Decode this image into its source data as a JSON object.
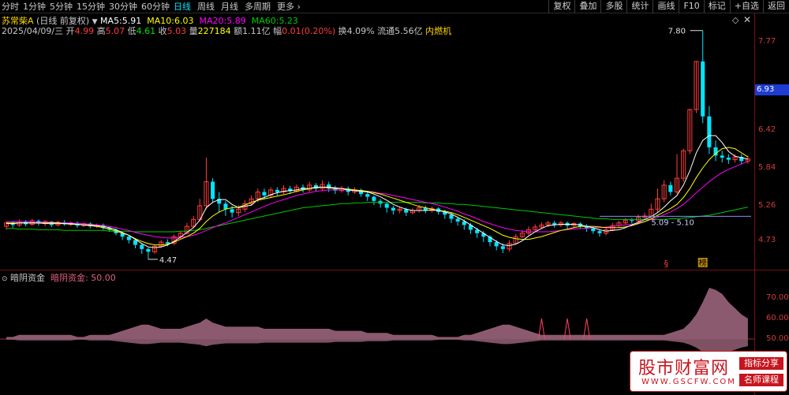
{
  "toolbar": {
    "periods": [
      "分时",
      "1分钟",
      "5分钟",
      "15分钟",
      "30分钟",
      "60分钟",
      "日线",
      "周线",
      "月线",
      "多周期",
      "更多"
    ],
    "active_period": "日线",
    "more_arrow": "›",
    "right_buttons": [
      "复权",
      "叠加",
      "多股",
      "统计",
      "画线",
      "F10",
      "标记",
      "+自选",
      "返回"
    ]
  },
  "stock": {
    "name": "苏常柴A",
    "mode": "(日线 前复权)",
    "ma5_label": "MA5:",
    "ma5": "5.91",
    "ma10_label": "MA10:",
    "ma10": "6.03",
    "ma20_label": "MA20:",
    "ma20": "5.89",
    "ma60_label": "MA60:",
    "ma60": "5.23"
  },
  "bar_info": {
    "date": "2025/04/09/三",
    "open_label": "开",
    "open": "4.99",
    "high_label": "高",
    "high": "5.07",
    "low_label": "低",
    "low": "4.61",
    "close_label": "收",
    "close": "5.03",
    "vol_label": "量",
    "vol": "227184",
    "amount_label": "额",
    "amount": "1.11亿",
    "chg_label": "幅",
    "chg": "0.01(0.20%)",
    "turnover_label": "换",
    "turnover": "4.09%",
    "float_label": "流通",
    "float": "5.56亿",
    "sector": "内燃机"
  },
  "price_axis": {
    "labels": [
      "7.77",
      "6.42",
      "5.84",
      "5.26",
      "4.73"
    ],
    "current": "6.93"
  },
  "annotations": {
    "high_mark": "7.80",
    "low_mark": "4.47",
    "range_text": "5.09 - 5.10",
    "marker_s": "§",
    "marker_box": "榜"
  },
  "indicator": {
    "name": "暗阴资金",
    "value_label": "暗阴资金:",
    "value": "50.00",
    "axis": [
      "70.00",
      "60.00",
      "50.00"
    ]
  },
  "watermark": {
    "logo": "股市财富网",
    "url": "WWW.GSCFW.COM",
    "tag1": "指标分享",
    "tag2": "名师课程"
  },
  "colors": {
    "up": "#ff3c3c",
    "down": "#00e5ff",
    "ma5": "#ffffff",
    "ma10": "#ffff00",
    "ma20": "#ff00ff",
    "ma60": "#00c800",
    "indicator_fill": "#8c5a6e"
  },
  "chart_data": {
    "type": "candlestick",
    "ylim": [
      4.4,
      7.9
    ],
    "candles": [
      [
        4.95,
        5.0,
        4.9,
        5.02
      ],
      [
        5.0,
        4.97,
        4.93,
        5.03
      ],
      [
        4.97,
        5.02,
        4.94,
        5.05
      ],
      [
        5.02,
        4.98,
        4.95,
        5.04
      ],
      [
        4.98,
        5.03,
        4.96,
        5.06
      ],
      [
        5.03,
        4.99,
        4.96,
        5.05
      ],
      [
        4.99,
        5.02,
        4.95,
        5.04
      ],
      [
        5.02,
        4.97,
        4.94,
        5.03
      ],
      [
        4.97,
        5.01,
        4.95,
        5.03
      ],
      [
        5.01,
        4.98,
        4.96,
        5.04
      ],
      [
        4.98,
        5.0,
        4.95,
        5.02
      ],
      [
        5.0,
        4.96,
        4.93,
        5.02
      ],
      [
        4.96,
        4.99,
        4.94,
        5.01
      ],
      [
        4.99,
        4.95,
        4.92,
        5.01
      ],
      [
        4.95,
        4.97,
        4.93,
        4.99
      ],
      [
        4.97,
        4.93,
        4.9,
        4.99
      ],
      [
        4.93,
        4.9,
        4.87,
        4.95
      ],
      [
        4.9,
        4.85,
        4.82,
        4.92
      ],
      [
        4.85,
        4.8,
        4.75,
        4.87
      ],
      [
        4.8,
        4.75,
        4.7,
        4.82
      ],
      [
        4.75,
        4.68,
        4.63,
        4.77
      ],
      [
        4.68,
        4.62,
        4.55,
        4.7
      ],
      [
        4.62,
        4.58,
        4.47,
        4.64
      ],
      [
        4.58,
        4.66,
        4.55,
        4.68
      ],
      [
        4.66,
        4.72,
        4.64,
        4.75
      ],
      [
        4.72,
        4.7,
        4.66,
        4.76
      ],
      [
        4.7,
        4.8,
        4.68,
        4.83
      ],
      [
        4.8,
        4.85,
        4.77,
        4.88
      ],
      [
        4.85,
        4.95,
        4.83,
        5.0
      ],
      [
        4.95,
        5.05,
        4.92,
        5.1
      ],
      [
        5.05,
        5.25,
        5.02,
        5.35
      ],
      [
        5.25,
        5.6,
        5.2,
        5.95
      ],
      [
        5.6,
        5.35,
        5.3,
        5.65
      ],
      [
        5.35,
        5.28,
        5.15,
        5.45
      ],
      [
        5.28,
        5.2,
        5.1,
        5.32
      ],
      [
        5.2,
        5.15,
        5.08,
        5.25
      ],
      [
        5.15,
        5.2,
        5.1,
        5.26
      ],
      [
        5.2,
        5.28,
        5.16,
        5.33
      ],
      [
        5.28,
        5.35,
        5.25,
        5.4
      ],
      [
        5.35,
        5.45,
        5.3,
        5.5
      ],
      [
        5.45,
        5.4,
        5.35,
        5.5
      ],
      [
        5.4,
        5.48,
        5.36,
        5.52
      ],
      [
        5.48,
        5.45,
        5.4,
        5.52
      ],
      [
        5.45,
        5.5,
        5.42,
        5.55
      ],
      [
        5.5,
        5.46,
        5.42,
        5.54
      ],
      [
        5.46,
        5.52,
        5.44,
        5.56
      ],
      [
        5.52,
        5.48,
        5.44,
        5.56
      ],
      [
        5.48,
        5.55,
        5.45,
        5.6
      ],
      [
        5.55,
        5.5,
        5.46,
        5.58
      ],
      [
        5.5,
        5.56,
        5.47,
        5.62
      ],
      [
        5.56,
        5.5,
        5.45,
        5.6
      ],
      [
        5.5,
        5.47,
        5.42,
        5.54
      ],
      [
        5.47,
        5.5,
        5.44,
        5.54
      ],
      [
        5.5,
        5.45,
        5.4,
        5.53
      ],
      [
        5.45,
        5.48,
        5.42,
        5.52
      ],
      [
        5.48,
        5.42,
        5.38,
        5.5
      ],
      [
        5.42,
        5.38,
        5.32,
        5.45
      ],
      [
        5.38,
        5.32,
        5.26,
        5.4
      ],
      [
        5.32,
        5.28,
        5.22,
        5.35
      ],
      [
        5.28,
        5.22,
        5.15,
        5.3
      ],
      [
        5.22,
        5.18,
        5.12,
        5.25
      ],
      [
        5.18,
        5.2,
        5.14,
        5.24
      ],
      [
        5.2,
        5.15,
        5.1,
        5.22
      ],
      [
        5.15,
        5.18,
        5.12,
        5.22
      ],
      [
        5.18,
        5.22,
        5.15,
        5.26
      ],
      [
        5.22,
        5.18,
        5.14,
        5.25
      ],
      [
        5.18,
        5.21,
        5.15,
        5.24
      ],
      [
        5.21,
        5.16,
        5.12,
        5.23
      ],
      [
        5.16,
        5.12,
        5.06,
        5.19
      ],
      [
        5.12,
        5.06,
        5.0,
        5.15
      ],
      [
        5.06,
        5.02,
        4.96,
        5.09
      ],
      [
        5.02,
        4.97,
        4.9,
        5.05
      ],
      [
        4.97,
        4.9,
        4.84,
        5.0
      ],
      [
        4.9,
        4.85,
        4.78,
        4.93
      ],
      [
        4.85,
        4.8,
        4.72,
        4.88
      ],
      [
        4.8,
        4.72,
        4.66,
        4.82
      ],
      [
        4.72,
        4.66,
        4.6,
        4.75
      ],
      [
        4.66,
        4.62,
        4.56,
        4.7
      ],
      [
        4.62,
        4.7,
        4.58,
        4.75
      ],
      [
        4.7,
        4.8,
        4.68,
        4.84
      ],
      [
        4.8,
        4.85,
        4.78,
        4.9
      ],
      [
        4.85,
        4.9,
        4.82,
        4.95
      ],
      [
        4.9,
        4.94,
        4.88,
        4.98
      ],
      [
        4.94,
        4.97,
        4.91,
        5.01
      ],
      [
        4.97,
        5.0,
        4.94,
        5.03
      ],
      [
        5.0,
        4.97,
        4.93,
        5.03
      ],
      [
        4.97,
        5.0,
        4.94,
        5.03
      ],
      [
        5.0,
        4.96,
        4.92,
        5.02
      ],
      [
        4.96,
        4.99,
        4.93,
        5.01
      ],
      [
        4.99,
        4.95,
        4.91,
        5.01
      ],
      [
        4.95,
        4.92,
        4.87,
        4.98
      ],
      [
        4.92,
        4.88,
        4.84,
        4.94
      ],
      [
        4.88,
        4.85,
        4.8,
        4.9
      ],
      [
        4.85,
        4.9,
        4.82,
        4.93
      ],
      [
        4.9,
        4.96,
        4.88,
        5.0
      ],
      [
        4.96,
        5.0,
        4.93,
        5.03
      ],
      [
        5.0,
        5.04,
        4.98,
        5.07
      ],
      [
        5.04,
        5.03,
        4.99,
        5.07
      ],
      [
        5.03,
        5.08,
        5.0,
        5.12
      ],
      [
        5.08,
        5.1,
        5.05,
        5.15
      ],
      [
        5.1,
        5.2,
        5.08,
        5.28
      ],
      [
        5.2,
        5.35,
        5.15,
        5.5
      ],
      [
        5.35,
        5.55,
        5.3,
        5.62
      ],
      [
        5.55,
        5.45,
        5.4,
        5.6
      ],
      [
        5.45,
        5.65,
        5.42,
        6.0
      ],
      [
        5.65,
        6.05,
        5.6,
        6.08
      ],
      [
        6.05,
        6.65,
        6.0,
        6.66
      ],
      [
        6.65,
        7.35,
        6.6,
        7.35
      ],
      [
        7.35,
        6.55,
        6.45,
        7.8
      ],
      [
        6.55,
        6.1,
        6.0,
        6.7
      ],
      [
        6.1,
        5.98,
        5.9,
        6.2
      ],
      [
        5.98,
        5.95,
        5.88,
        6.05
      ],
      [
        5.95,
        5.92,
        5.86,
        6.0
      ],
      [
        5.92,
        5.96,
        5.88,
        6.0
      ],
      [
        5.96,
        5.9,
        5.85,
        6.0
      ],
      [
        5.9,
        5.93,
        5.86,
        5.98
      ]
    ],
    "ma5": [
      4.99,
      4.99,
      5.0,
      5.0,
      5.0,
      5.0,
      5.0,
      5.0,
      5.0,
      4.99,
      4.99,
      4.98,
      4.97,
      4.97,
      4.96,
      4.95,
      4.93,
      4.9,
      4.86,
      4.82,
      4.76,
      4.7,
      4.65,
      4.64,
      4.65,
      4.68,
      4.73,
      4.79,
      4.86,
      4.93,
      5.04,
      5.22,
      5.3,
      5.34,
      5.34,
      5.27,
      5.22,
      5.24,
      5.26,
      5.34,
      5.37,
      5.41,
      5.44,
      5.46,
      5.47,
      5.48,
      5.5,
      5.5,
      5.52,
      5.52,
      5.52,
      5.51,
      5.5,
      5.48,
      5.47,
      5.46,
      5.45,
      5.42,
      5.38,
      5.33,
      5.27,
      5.23,
      5.2,
      5.18,
      5.18,
      5.18,
      5.19,
      5.18,
      5.16,
      5.13,
      5.08,
      5.03,
      4.97,
      4.91,
      4.85,
      4.79,
      4.73,
      4.68,
      4.67,
      4.69,
      4.74,
      4.81,
      4.87,
      4.92,
      4.96,
      4.97,
      4.98,
      4.98,
      4.98,
      4.97,
      4.95,
      4.93,
      4.9,
      4.88,
      4.89,
      4.9,
      4.93,
      4.97,
      5.01,
      5.05,
      5.09,
      5.15,
      5.23,
      5.32,
      5.4,
      5.55,
      5.76,
      6.02,
      6.2,
      6.27,
      6.27,
      6.17,
      6.04,
      5.97,
      5.95,
      5.93
    ],
    "ma10": [
      5.0,
      5.0,
      5.0,
      5.0,
      5.0,
      5.0,
      4.99,
      4.99,
      4.99,
      4.99,
      4.98,
      4.98,
      4.97,
      4.96,
      4.95,
      4.93,
      4.91,
      4.88,
      4.85,
      4.82,
      4.77,
      4.73,
      4.7,
      4.68,
      4.68,
      4.69,
      4.72,
      4.76,
      4.8,
      4.85,
      4.92,
      5.02,
      5.1,
      5.16,
      5.2,
      5.22,
      5.23,
      5.26,
      5.3,
      5.33,
      5.35,
      5.37,
      5.39,
      5.41,
      5.43,
      5.46,
      5.48,
      5.5,
      5.51,
      5.52,
      5.51,
      5.5,
      5.5,
      5.49,
      5.48,
      5.47,
      5.46,
      5.44,
      5.42,
      5.39,
      5.36,
      5.33,
      5.3,
      5.27,
      5.24,
      5.22,
      5.2,
      5.18,
      5.17,
      5.15,
      5.12,
      5.08,
      5.04,
      5.0,
      4.96,
      4.92,
      4.87,
      4.82,
      4.79,
      4.77,
      4.76,
      4.76,
      4.78,
      4.8,
      4.83,
      4.86,
      4.89,
      4.91,
      4.93,
      4.95,
      4.95,
      4.95,
      4.94,
      4.93,
      4.93,
      4.93,
      4.94,
      4.96,
      4.99,
      5.02,
      5.06,
      5.11,
      5.16,
      5.21,
      5.27,
      5.37,
      5.5,
      5.66,
      5.8,
      5.92,
      6.01,
      6.08,
      6.1,
      6.08,
      6.02,
      5.96
    ],
    "ma20": [
      5.02,
      5.02,
      5.02,
      5.02,
      5.01,
      5.01,
      5.01,
      5.01,
      5.0,
      5.0,
      5.0,
      4.99,
      4.99,
      4.98,
      4.97,
      4.96,
      4.95,
      4.93,
      4.91,
      4.89,
      4.86,
      4.84,
      4.82,
      4.8,
      4.79,
      4.78,
      4.78,
      4.79,
      4.8,
      4.82,
      4.85,
      4.89,
      4.93,
      4.97,
      5.0,
      5.04,
      5.08,
      5.12,
      5.16,
      5.2,
      5.24,
      5.28,
      5.31,
      5.34,
      5.37,
      5.4,
      5.42,
      5.44,
      5.46,
      5.47,
      5.48,
      5.48,
      5.48,
      5.48,
      5.47,
      5.47,
      5.46,
      5.45,
      5.43,
      5.42,
      5.4,
      5.38,
      5.36,
      5.34,
      5.32,
      5.3,
      5.28,
      5.26,
      5.23,
      5.2,
      5.17,
      5.13,
      5.1,
      5.06,
      5.02,
      4.99,
      4.96,
      4.93,
      4.91,
      4.89,
      4.88,
      4.87,
      4.87,
      4.87,
      4.87,
      4.88,
      4.89,
      4.9,
      4.91,
      4.92,
      4.92,
      4.93,
      4.93,
      4.94,
      4.95,
      4.96,
      4.97,
      4.98,
      5.0,
      5.02,
      5.05,
      5.08,
      5.12,
      5.16,
      5.21,
      5.27,
      5.35,
      5.44,
      5.52,
      5.6,
      5.67,
      5.73,
      5.78,
      5.82,
      5.86,
      5.89
    ],
    "ma60": [
      4.92,
      4.92,
      4.91,
      4.91,
      4.91,
      4.9,
      4.9,
      4.9,
      4.9,
      4.89,
      4.89,
      4.89,
      4.89,
      4.89,
      4.89,
      4.89,
      4.88,
      4.88,
      4.88,
      4.88,
      4.87,
      4.87,
      4.87,
      4.87,
      4.87,
      4.87,
      4.87,
      4.88,
      4.88,
      4.89,
      4.9,
      4.92,
      4.94,
      4.96,
      4.98,
      5.0,
      5.02,
      5.04,
      5.06,
      5.08,
      5.1,
      5.12,
      5.14,
      5.16,
      5.18,
      5.2,
      5.22,
      5.23,
      5.24,
      5.25,
      5.26,
      5.27,
      5.28,
      5.28,
      5.29,
      5.29,
      5.3,
      5.3,
      5.3,
      5.3,
      5.3,
      5.3,
      5.3,
      5.3,
      5.3,
      5.29,
      5.29,
      5.29,
      5.28,
      5.28,
      5.27,
      5.27,
      5.26,
      5.25,
      5.24,
      5.23,
      5.22,
      5.21,
      5.2,
      5.19,
      5.18,
      5.17,
      5.16,
      5.15,
      5.14,
      5.13,
      5.12,
      5.11,
      5.1,
      5.09,
      5.08,
      5.07,
      5.06,
      5.06,
      5.05,
      5.05,
      5.05,
      5.05,
      5.05,
      5.05,
      5.05,
      5.05,
      5.05,
      5.06,
      5.06,
      5.07,
      5.08,
      5.09,
      5.1,
      5.11,
      5.13,
      5.15,
      5.17,
      5.19,
      5.21,
      5.23
    ],
    "indicator_values": [
      51,
      51,
      52,
      52,
      52,
      52,
      52,
      52,
      52,
      52,
      52,
      51,
      51,
      52,
      52,
      52,
      52,
      53,
      54,
      55,
      56,
      57,
      57,
      56,
      55,
      55,
      55,
      55,
      56,
      57,
      58,
      60,
      58,
      57,
      56,
      56,
      56,
      56,
      56,
      56,
      55,
      55,
      55,
      55,
      55,
      55,
      55,
      55,
      55,
      55,
      55,
      54,
      54,
      54,
      54,
      54,
      53,
      53,
      53,
      53,
      52,
      52,
      52,
      52,
      52,
      52,
      52,
      51,
      51,
      51,
      51,
      52,
      52,
      53,
      54,
      55,
      56,
      57,
      57,
      56,
      55,
      54,
      53,
      52,
      52,
      52,
      52,
      52,
      52,
      52,
      52,
      52,
      52,
      52,
      52,
      52,
      52,
      52,
      52,
      52,
      52,
      52,
      52,
      53,
      54,
      55,
      58,
      62,
      68,
      75,
      74,
      72,
      68,
      65,
      62,
      60
    ]
  }
}
